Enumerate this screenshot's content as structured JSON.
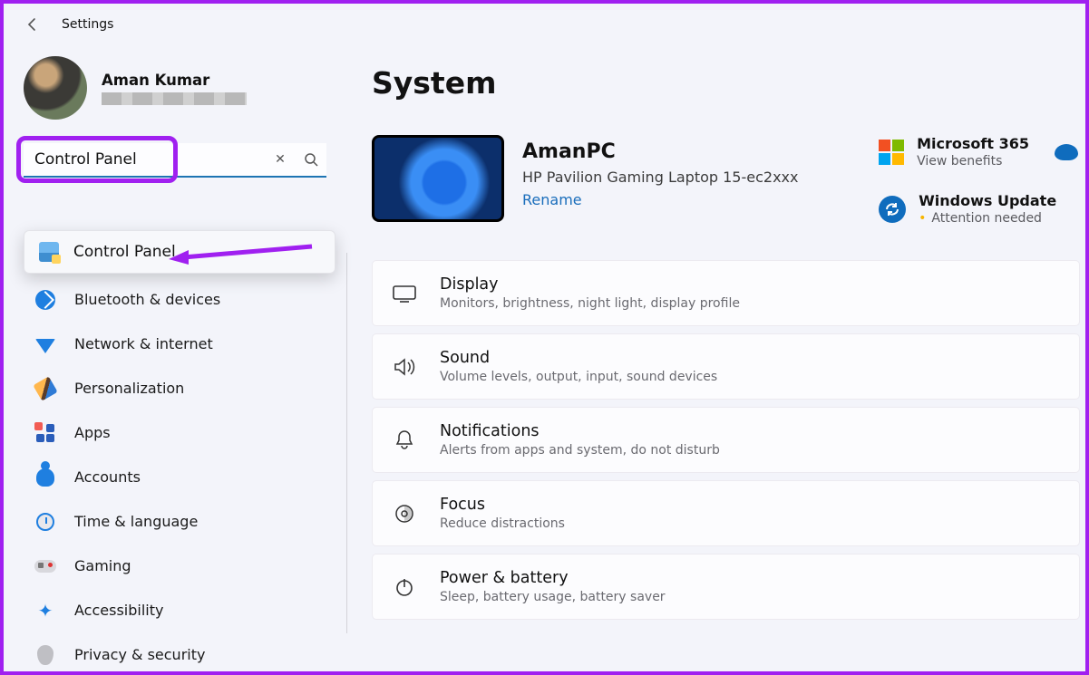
{
  "app": {
    "title": "Settings"
  },
  "user": {
    "name": "Aman Kumar"
  },
  "search": {
    "value": "Control Panel"
  },
  "suggest": {
    "label": "Control Panel"
  },
  "nav": [
    {
      "id": "bluetooth",
      "label": "Bluetooth & devices"
    },
    {
      "id": "network",
      "label": "Network & internet"
    },
    {
      "id": "personalization",
      "label": "Personalization"
    },
    {
      "id": "apps",
      "label": "Apps"
    },
    {
      "id": "accounts",
      "label": "Accounts"
    },
    {
      "id": "time",
      "label": "Time & language"
    },
    {
      "id": "gaming",
      "label": "Gaming"
    },
    {
      "id": "accessibility",
      "label": "Accessibility"
    },
    {
      "id": "privacy",
      "label": "Privacy & security"
    }
  ],
  "page": {
    "title": "System",
    "pc": {
      "name": "AmanPC",
      "model": "HP Pavilion Gaming Laptop 15-ec2xxx",
      "rename": "Rename"
    },
    "tiles": {
      "m365": {
        "title": "Microsoft 365",
        "sub": "View benefits"
      },
      "winup": {
        "title": "Windows Update",
        "sub": "Attention needed"
      }
    },
    "cards": [
      {
        "id": "display",
        "title": "Display",
        "sub": "Monitors, brightness, night light, display profile"
      },
      {
        "id": "sound",
        "title": "Sound",
        "sub": "Volume levels, output, input, sound devices"
      },
      {
        "id": "notifs",
        "title": "Notifications",
        "sub": "Alerts from apps and system, do not disturb"
      },
      {
        "id": "focus",
        "title": "Focus",
        "sub": "Reduce distractions"
      },
      {
        "id": "power",
        "title": "Power & battery",
        "sub": "Sleep, battery usage, battery saver"
      }
    ]
  }
}
